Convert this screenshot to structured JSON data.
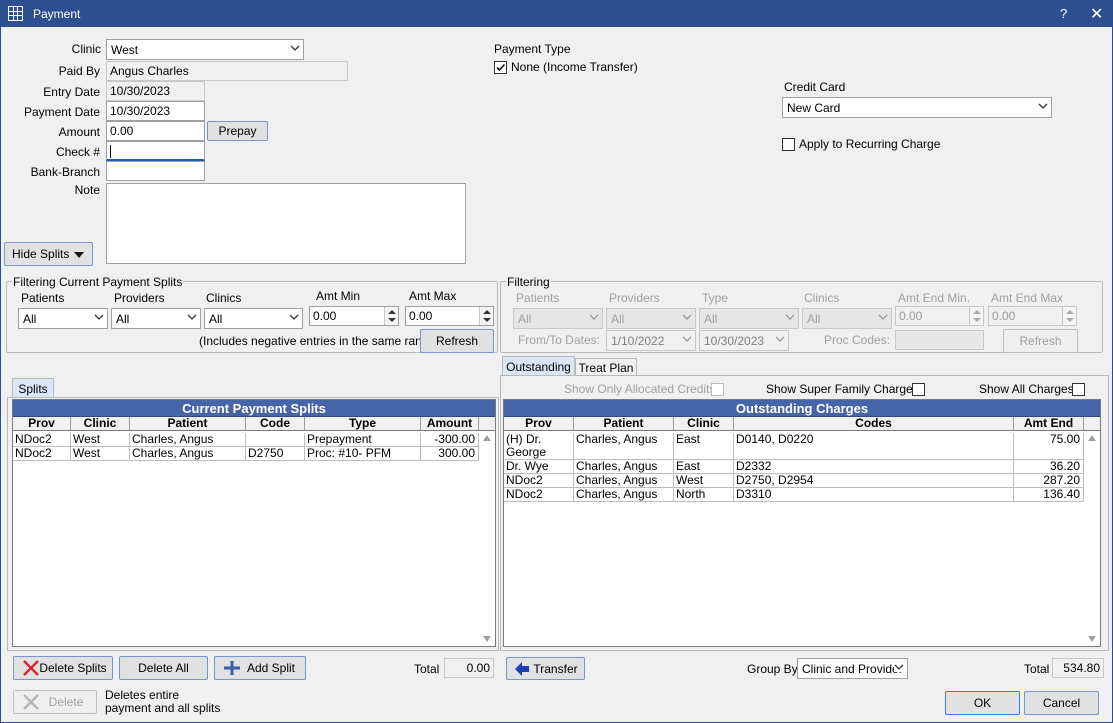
{
  "window": {
    "title": "Payment",
    "help_label": "?",
    "close_label": "✕"
  },
  "form": {
    "clinic_label": "Clinic",
    "clinic_value": "West",
    "paid_by_label": "Paid By",
    "paid_by_value": "Angus Charles",
    "entry_date_label": "Entry Date",
    "entry_date_value": "10/30/2023",
    "payment_date_label": "Payment Date",
    "payment_date_value": "10/30/2023",
    "amount_label": "Amount",
    "amount_value": "0.00",
    "prepay_label": "Prepay",
    "check_label": "Check #",
    "check_value": "",
    "bank_label": "Bank-Branch",
    "bank_value": "",
    "note_label": "Note",
    "note_value": "",
    "hide_splits_label": "Hide Splits"
  },
  "payment_type": {
    "label": "Payment Type",
    "none_label": "None (Income Transfer)",
    "none_checked": true
  },
  "credit_card": {
    "label": "Credit Card",
    "value": "New Card",
    "recurring_label": "Apply to Recurring Charge",
    "recurring_checked": false
  },
  "filter_left": {
    "title": "Filtering Current Payment Splits",
    "patients_label": "Patients",
    "patients_value": "All",
    "providers_label": "Providers",
    "providers_value": "All",
    "clinics_label": "Clinics",
    "clinics_value": "All",
    "amt_min_label": "Amt Min",
    "amt_min_value": "0.00",
    "amt_max_label": "Amt Max",
    "amt_max_value": "0.00",
    "note": "(Includes negative entries in the same range)",
    "refresh_label": "Refresh"
  },
  "filter_right": {
    "title": "Filtering",
    "patients_label": "Patients",
    "patients_value": "All",
    "providers_label": "Providers",
    "providers_value": "All",
    "type_label": "Type",
    "type_value": "All",
    "clinics_label": "Clinics",
    "clinics_value": "All",
    "amt_end_min_label": "Amt End Min.",
    "amt_end_min_value": "0.00",
    "amt_end_max_label": "Amt End Max",
    "amt_end_max_value": "0.00",
    "from_to_label": "From/To Dates:",
    "from_value": "1/10/2022",
    "to_value": "10/30/2023",
    "proc_codes_label": "Proc Codes:",
    "proc_codes_value": "",
    "refresh_label": "Refresh"
  },
  "left_tabs": [
    "Splits"
  ],
  "right_tabs": [
    "Outstanding",
    "Treat Plan"
  ],
  "right_options": {
    "allocated_label": "Show Only Allocated Credits",
    "super_family_label": "Show Super Family Charges",
    "all_charges_label": "Show All Charges"
  },
  "splits_grid": {
    "title": "Current Payment Splits",
    "columns": [
      "Prov",
      "Clinic",
      "Patient",
      "Code",
      "Type",
      "Amount"
    ],
    "rows": [
      [
        "NDoc2",
        "West",
        "Charles, Angus",
        "",
        "Prepayment",
        "-300.00"
      ],
      [
        "NDoc2",
        "West",
        "Charles, Angus",
        "D2750",
        "Proc: #10- PFM",
        "300.00"
      ]
    ]
  },
  "charges_grid": {
    "title": "Outstanding Charges",
    "columns": [
      "Prov",
      "Patient",
      "Clinic",
      "Codes",
      "Amt End"
    ],
    "rows": [
      [
        "(H) Dr. George",
        "Charles, Angus",
        "East",
        "D0140, D0220",
        "75.00"
      ],
      [
        "Dr. Wye",
        "Charles, Angus",
        "East",
        "D2332",
        "36.20"
      ],
      [
        "NDoc2",
        "Charles, Angus",
        "West",
        "D2750, D2954",
        "287.20"
      ],
      [
        "NDoc2",
        "Charles, Angus",
        "North",
        "D3310",
        "136.40"
      ]
    ]
  },
  "bottom_left": {
    "delete_splits_label": "Delete Splits",
    "delete_all_label": "Delete All",
    "add_split_label": "Add Split",
    "total_label": "Total",
    "total_value": "0.00",
    "delete_label": "Delete",
    "delete_note": "Deletes entire payment and all splits"
  },
  "bottom_right": {
    "transfer_label": "Transfer",
    "group_by_label": "Group By",
    "group_by_value": "Clinic and Provider",
    "total_label": "Total",
    "total_value": "534.80",
    "ok_label": "OK",
    "cancel_label": "Cancel"
  },
  "colors": {
    "title_bar": "#2e4f8f",
    "grid_header": "#4665a8",
    "delete_red": "#d9232d",
    "transfer_blue": "#1f3fb5",
    "add_blue": "#3a5fb0"
  }
}
